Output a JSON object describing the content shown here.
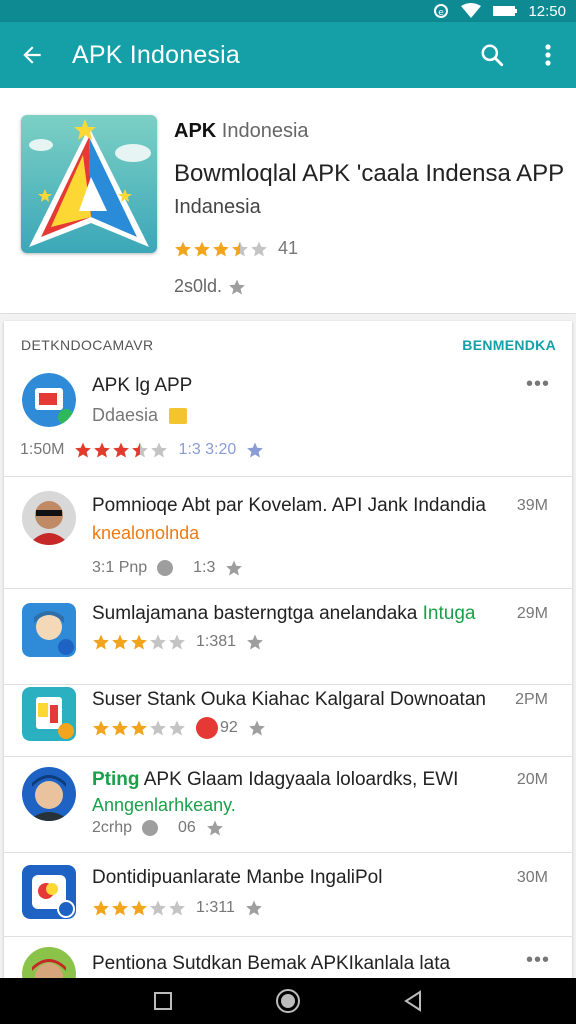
{
  "status_bar": {
    "time": "12:50"
  },
  "app_bar": {
    "title": "APK Indonesia"
  },
  "hero": {
    "name_bold": "APK",
    "name_light": "Indonesia",
    "title": "Bowmloqlal APK 'caala Indensa APP",
    "subtitle": "Indanesia",
    "rating": 3.5,
    "rating_count": "41",
    "meta": "2s0ld."
  },
  "section": {
    "title": "DETKNDOCAMAVR",
    "link": "BENMENDKA"
  },
  "rows": [
    {
      "name": "APK lg APP",
      "sub": "Ddaesia",
      "meta_left": "1:50M",
      "rating": 3.5,
      "meta_right": "1:3 3:20"
    },
    {
      "name": "Pomnioqe Abt par Kovelam. API Jank Indandia",
      "sub": "knealonolnda",
      "size": "39M",
      "meta_left": "3:1 Pnp",
      "meta_right": "1:3"
    },
    {
      "name": "Sumlajamana basterngtga anelandaka",
      "name_hl": "Intuga",
      "size": "29M",
      "rating": 3,
      "meta_right": "1:381"
    },
    {
      "name": "Suser Stank Ouka Kiahac Kalgaral Downoatan",
      "size": "2PM",
      "rating": 3,
      "meta_right": "92"
    },
    {
      "name_hl": "Pting",
      "name": "APK Glaam Idagyaala loloardks, EWI",
      "sub": "Anngenlarhkeany.",
      "size": "20M",
      "meta_left": "2crhp",
      "meta_right": "06"
    },
    {
      "name": "Dontidipuanlarate Manbe IngaliPol",
      "size": "30M",
      "rating": 3,
      "meta_right": "1:311"
    },
    {
      "name": "Pentiona Sutdkan Bemak APKIkanlala lata"
    }
  ],
  "colors": {
    "teal": "#15a0a8",
    "teal_dark": "#0e8a93",
    "star_orange": "#f2a41c",
    "star_red": "#e23b2e",
    "star_gray": "#bdbdbd",
    "green": "#1ba04a",
    "orange_text": "#f07a12"
  }
}
